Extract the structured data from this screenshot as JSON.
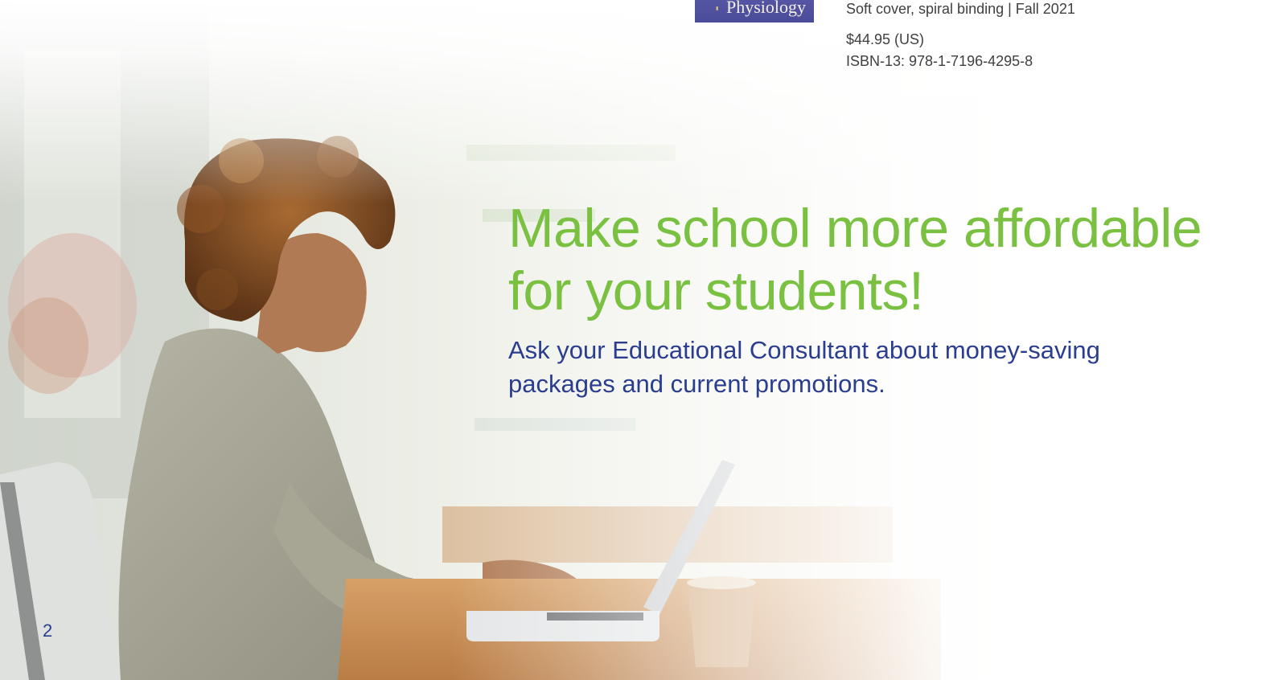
{
  "book": {
    "cover_title": "Physiology",
    "binding": "Soft cover, spiral binding | Fall 2021",
    "price": "$44.95 (US)",
    "isbn": "ISBN-13: 978-1-7196-4295-8"
  },
  "promo": {
    "headline_line1": "Make school more affordable",
    "headline_line2": "for your students!",
    "subtext_line1": "Ask your Educational Consultant about money-saving",
    "subtext_line2": "packages and current promotions."
  },
  "page_number": "2",
  "colors": {
    "headline": "#7ac142",
    "subtext": "#2a3d8f",
    "cover": "#4a4b99",
    "info_text": "#3f3f3f"
  }
}
